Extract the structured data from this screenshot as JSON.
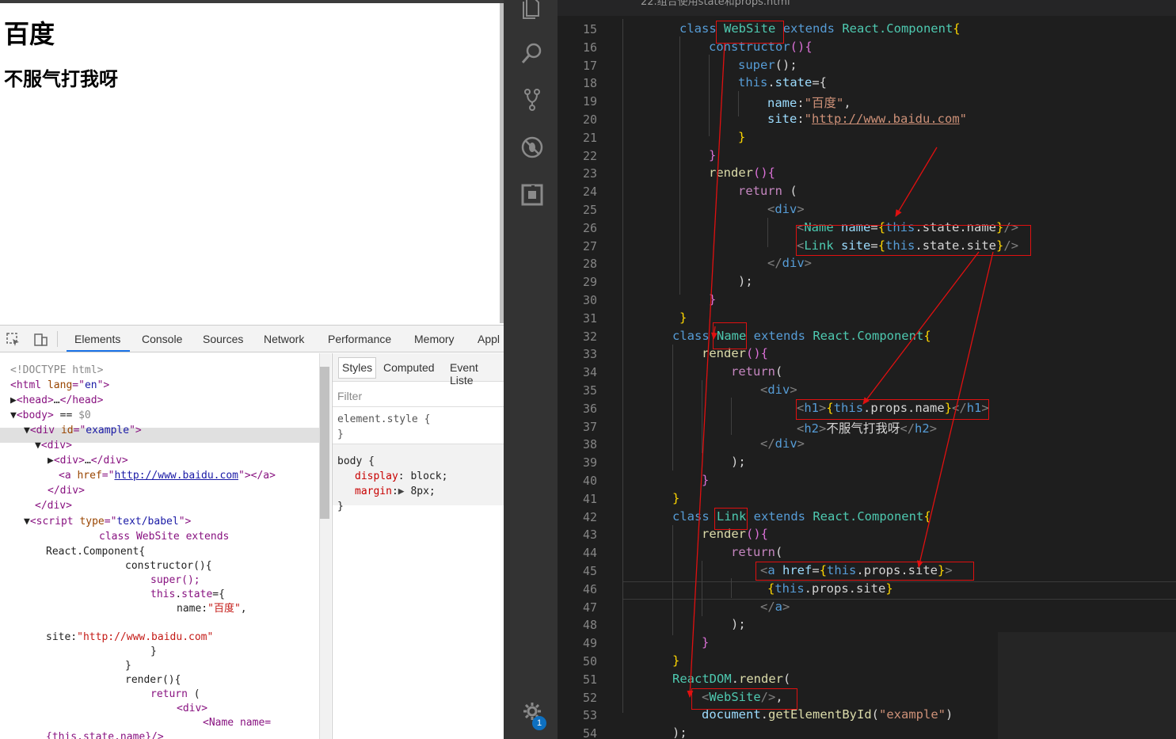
{
  "page": {
    "h1": "百度",
    "h2": "不服气打我呀"
  },
  "devtools": {
    "tabs": [
      "Elements",
      "Console",
      "Sources",
      "Network",
      "Performance",
      "Memory",
      "Appl"
    ],
    "dom_lines": [
      {
        "parts": [
          [
            "cm",
            "<!DOCTYPE html>"
          ]
        ]
      },
      {
        "parts": [
          [
            "tag",
            "<html "
          ],
          [
            "attr",
            "lang"
          ],
          [
            "tag",
            "=\""
          ],
          [
            "val",
            "en"
          ],
          [
            "tag",
            "\">"
          ]
        ]
      },
      {
        "parts": [
          [
            "plain",
            "▶"
          ],
          [
            "tag",
            "<head>"
          ],
          [
            "plain",
            "…"
          ],
          [
            "tag",
            "</head>"
          ]
        ]
      },
      {
        "parts": [
          [
            "plain",
            "▼"
          ],
          [
            "tag",
            "<body>"
          ],
          [
            "plain",
            " == "
          ],
          [
            "cm",
            "$0"
          ]
        ]
      },
      {
        "parts": [
          [
            "plain",
            "▼"
          ],
          [
            "tag",
            "<div "
          ],
          [
            "attr",
            "id"
          ],
          [
            "tag",
            "=\""
          ],
          [
            "val",
            "example"
          ],
          [
            "tag",
            "\">"
          ]
        ]
      },
      {
        "parts": [
          [
            "plain",
            "▼"
          ],
          [
            "tag",
            "<div>"
          ]
        ]
      },
      {
        "parts": [
          [
            "plain",
            "▶"
          ],
          [
            "tag",
            "<div>"
          ],
          [
            "plain",
            "…"
          ],
          [
            "tag",
            "</div>"
          ]
        ]
      },
      {
        "parts": [
          [
            "tag",
            "<a "
          ],
          [
            "attr",
            "href"
          ],
          [
            "tag",
            "=\""
          ],
          [
            "val-u",
            "http://www.baidu.com"
          ],
          [
            "tag",
            "\"></a>"
          ]
        ]
      },
      {
        "parts": [
          [
            "tag",
            "</div>"
          ]
        ]
      },
      {
        "parts": [
          [
            "tag",
            "</div>"
          ]
        ]
      },
      {
        "parts": [
          [
            "plain",
            "▼"
          ],
          [
            "tag",
            "<script "
          ],
          [
            "attr",
            "type"
          ],
          [
            "tag",
            "=\""
          ],
          [
            "val",
            "text/babel"
          ],
          [
            "tag",
            "\">"
          ]
        ]
      },
      {
        "parts": [
          [
            "tag",
            "class WebSite extends"
          ]
        ]
      },
      {
        "parts": [
          [
            "plain",
            "React.Component{"
          ]
        ]
      },
      {
        "parts": [
          [
            "plain",
            "constructor(){"
          ]
        ]
      },
      {
        "parts": [
          [
            "tag",
            "super();"
          ]
        ]
      },
      {
        "parts": [
          [
            "tag",
            "this"
          ],
          [
            "plain",
            "."
          ],
          [
            "tag",
            "state"
          ],
          [
            "plain",
            "={"
          ]
        ]
      },
      {
        "parts": [
          [
            "plain",
            "name:"
          ],
          [
            "str",
            "\"百度\""
          ],
          [
            "plain",
            ","
          ]
        ]
      },
      {
        "parts": [
          [
            "plain",
            "site:"
          ],
          [
            "str",
            "\"http://www.baidu.com\""
          ]
        ]
      },
      {
        "parts": [
          [
            "plain",
            "}"
          ]
        ]
      },
      {
        "parts": [
          [
            "plain",
            "}"
          ]
        ]
      },
      {
        "parts": [
          [
            "plain",
            "render(){"
          ]
        ]
      },
      {
        "parts": [
          [
            "tag",
            "return"
          ],
          [
            "plain",
            " ("
          ]
        ]
      },
      {
        "parts": [
          [
            "tag",
            "<div>"
          ]
        ]
      },
      {
        "parts": [
          [
            "tag",
            "<Name name="
          ]
        ]
      },
      {
        "parts": [
          [
            "tag",
            "{this.state.name}/>"
          ]
        ]
      }
    ],
    "styles_tabs": [
      "Styles",
      "Computed",
      "Event Liste"
    ],
    "filter_placeholder": "Filter",
    "element_style": [
      "element.style {",
      "}"
    ],
    "body_rule": {
      "selector": "body {",
      "display_prop": "display",
      "display_val": "block;",
      "margin_prop": "margin",
      "margin_val": "8px;",
      "close": "}"
    }
  },
  "editor": {
    "tab_title": "22.组合使用state和props.html",
    "notification_count": "1",
    "line_numbers": [
      "15",
      "16",
      "17",
      "18",
      "19",
      "20",
      "21",
      "22",
      "23",
      "24",
      "25",
      "26",
      "27",
      "28",
      "29",
      "30",
      "31",
      "32",
      "33",
      "34",
      "35",
      "36",
      "37",
      "38",
      "39",
      "40",
      "41",
      "42",
      "43",
      "44",
      "45",
      "46",
      "47",
      "48",
      "49",
      "50",
      "51",
      "52",
      "53",
      "54"
    ],
    "code": [
      [
        [
          "kw",
          "class "
        ],
        [
          "cls",
          "WebSite "
        ],
        [
          "kw",
          "extends "
        ],
        [
          "cls",
          "React.Component"
        ],
        [
          "br",
          "{"
        ]
      ],
      [
        [
          "kw",
          "constructor"
        ],
        [
          "br2",
          "()"
        ],
        [
          "br2",
          "{"
        ]
      ],
      [
        [
          "kw",
          "super"
        ],
        [
          "txt",
          "();"
        ]
      ],
      [
        [
          "kw",
          "this"
        ],
        [
          "txt",
          "."
        ],
        [
          "var",
          "state"
        ],
        [
          "txt",
          "={"
        ]
      ],
      [
        [
          "var",
          "name"
        ],
        [
          "txt",
          ":"
        ],
        [
          "str",
          "\"百度\""
        ],
        [
          "txt",
          ","
        ]
      ],
      [
        [
          "var",
          "site"
        ],
        [
          "txt",
          ":"
        ],
        [
          "str",
          "\""
        ],
        [
          "str-u",
          "http://www.baidu.com"
        ],
        [
          "str",
          "\""
        ]
      ],
      [
        [
          "br",
          "}"
        ]
      ],
      [
        [
          "br2",
          "}"
        ]
      ],
      [
        [
          "fn",
          "render"
        ],
        [
          "br2",
          "()"
        ],
        [
          "br2",
          "{"
        ]
      ],
      [
        [
          "ret",
          "return "
        ],
        [
          "txt",
          "("
        ]
      ],
      [
        [
          "tg",
          "<"
        ],
        [
          "tn",
          "div"
        ],
        [
          "tg",
          ">"
        ]
      ],
      [
        [
          "tg",
          "<"
        ],
        [
          "cls",
          "Name "
        ],
        [
          "at",
          "name"
        ],
        [
          "txt",
          "="
        ],
        [
          "br",
          "{"
        ],
        [
          "kw",
          "this"
        ],
        [
          "txt",
          ".state.name"
        ],
        [
          "br",
          "}"
        ],
        [
          "tg",
          "/>"
        ]
      ],
      [
        [
          "tg",
          "<"
        ],
        [
          "cls",
          "Link "
        ],
        [
          "at",
          "site"
        ],
        [
          "txt",
          "="
        ],
        [
          "br",
          "{"
        ],
        [
          "kw",
          "this"
        ],
        [
          "txt",
          ".state.site"
        ],
        [
          "br",
          "}"
        ],
        [
          "tg",
          "/>"
        ]
      ],
      [
        [
          "tg",
          "</"
        ],
        [
          "tn",
          "div"
        ],
        [
          "tg",
          ">"
        ]
      ],
      [
        [
          "txt",
          ");"
        ]
      ],
      [
        [
          "br2",
          "}"
        ]
      ],
      [
        [
          "br",
          "}"
        ]
      ],
      [
        [
          "kw",
          "class "
        ],
        [
          "cls",
          "Name "
        ],
        [
          "kw",
          "extends "
        ],
        [
          "cls",
          "React.Component"
        ],
        [
          "br",
          "{"
        ]
      ],
      [
        [
          "fn",
          "render"
        ],
        [
          "br2",
          "()"
        ],
        [
          "br2",
          "{"
        ]
      ],
      [
        [
          "ret",
          "return"
        ],
        [
          "txt",
          "("
        ]
      ],
      [
        [
          "tg",
          "<"
        ],
        [
          "tn",
          "div"
        ],
        [
          "tg",
          ">"
        ]
      ],
      [
        [
          "tg",
          "<"
        ],
        [
          "tn",
          "h1"
        ],
        [
          "tg",
          ">"
        ],
        [
          "br",
          "{"
        ],
        [
          "kw",
          "this"
        ],
        [
          "txt",
          ".props.name"
        ],
        [
          "br",
          "}"
        ],
        [
          "tg",
          "</"
        ],
        [
          "tn",
          "h1"
        ],
        [
          "tg",
          ">"
        ]
      ],
      [
        [
          "tg",
          "<"
        ],
        [
          "tn",
          "h2"
        ],
        [
          "tg",
          ">"
        ],
        [
          "txt",
          "不服气打我呀"
        ],
        [
          "tg",
          "</"
        ],
        [
          "tn",
          "h2"
        ],
        [
          "tg",
          ">"
        ]
      ],
      [
        [
          "tg",
          "</"
        ],
        [
          "tn",
          "div"
        ],
        [
          "tg",
          ">"
        ]
      ],
      [
        [
          "txt",
          ");"
        ]
      ],
      [
        [
          "br2",
          "}"
        ]
      ],
      [
        [
          "br",
          "}"
        ]
      ],
      [
        [
          "kw",
          "class "
        ],
        [
          "cls",
          "Link "
        ],
        [
          "kw",
          "extends "
        ],
        [
          "cls",
          "React.Component"
        ],
        [
          "br",
          "{"
        ]
      ],
      [
        [
          "fn",
          "render"
        ],
        [
          "br2",
          "()"
        ],
        [
          "br2",
          "{"
        ]
      ],
      [
        [
          "ret",
          "return"
        ],
        [
          "txt",
          "("
        ]
      ],
      [
        [
          "tg",
          "<"
        ],
        [
          "tn",
          "a "
        ],
        [
          "at",
          "href"
        ],
        [
          "txt",
          "="
        ],
        [
          "br",
          "{"
        ],
        [
          "kw",
          "this"
        ],
        [
          "txt",
          ".props.site"
        ],
        [
          "br",
          "}"
        ],
        [
          "tg",
          ">"
        ]
      ],
      [
        [
          "br",
          "{"
        ],
        [
          "kw",
          "this"
        ],
        [
          "txt",
          ".props.site"
        ],
        [
          "br",
          "}"
        ]
      ],
      [
        [
          "tg",
          "</"
        ],
        [
          "tn",
          "a"
        ],
        [
          "tg",
          ">"
        ]
      ],
      [
        [
          "txt",
          ");"
        ]
      ],
      [
        [
          "br2",
          "}"
        ]
      ],
      [
        [
          "br",
          "}"
        ]
      ],
      [
        [
          "cls",
          "ReactDOM"
        ],
        [
          "txt",
          "."
        ],
        [
          "fn",
          "render"
        ],
        [
          "txt",
          "("
        ]
      ],
      [
        [
          "tg",
          "<"
        ],
        [
          "cls",
          "WebSite"
        ],
        [
          "tg",
          "/>"
        ],
        [
          "txt",
          ","
        ]
      ],
      [
        [
          "var",
          "document"
        ],
        [
          "txt",
          "."
        ],
        [
          "fn",
          "getElementById"
        ],
        [
          "txt",
          "("
        ],
        [
          "str",
          "\"example\""
        ],
        [
          "txt",
          ")"
        ]
      ],
      [
        [
          "txt",
          ");"
        ]
      ]
    ]
  }
}
